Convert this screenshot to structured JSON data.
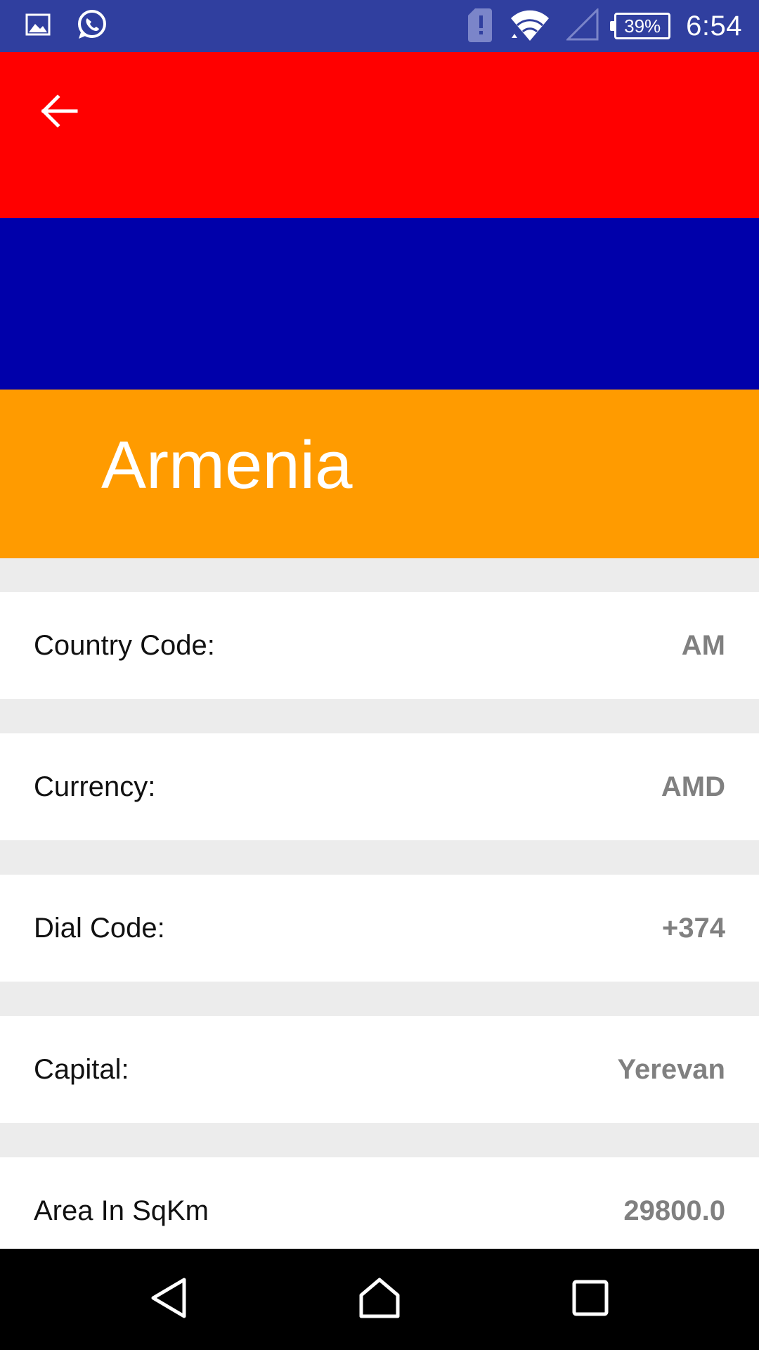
{
  "status_bar": {
    "left_icons": [
      "image-icon",
      "whatsapp-icon"
    ],
    "right_icons": [
      "sim-alert-icon",
      "wifi-icon",
      "cell-signal-icon",
      "battery-icon"
    ],
    "battery_percent": "39%",
    "time": "6:54",
    "background_color": "#303f9f"
  },
  "header": {
    "back_icon": "arrow-left-icon",
    "country_name": "Armenia",
    "flag_colors": [
      "#ff0000",
      "#0000aa",
      "#ff9b00"
    ]
  },
  "details": [
    {
      "label": "Country Code:",
      "value": "AM"
    },
    {
      "label": "Currency:",
      "value": "AMD"
    },
    {
      "label": "Dial Code:",
      "value": "+374"
    },
    {
      "label": "Capital:",
      "value": "Yerevan"
    },
    {
      "label": "Area In SqKm",
      "value": "29800.0"
    }
  ],
  "nav_bar": {
    "icons": [
      "back-triangle-icon",
      "home-icon",
      "recents-icon"
    ]
  }
}
